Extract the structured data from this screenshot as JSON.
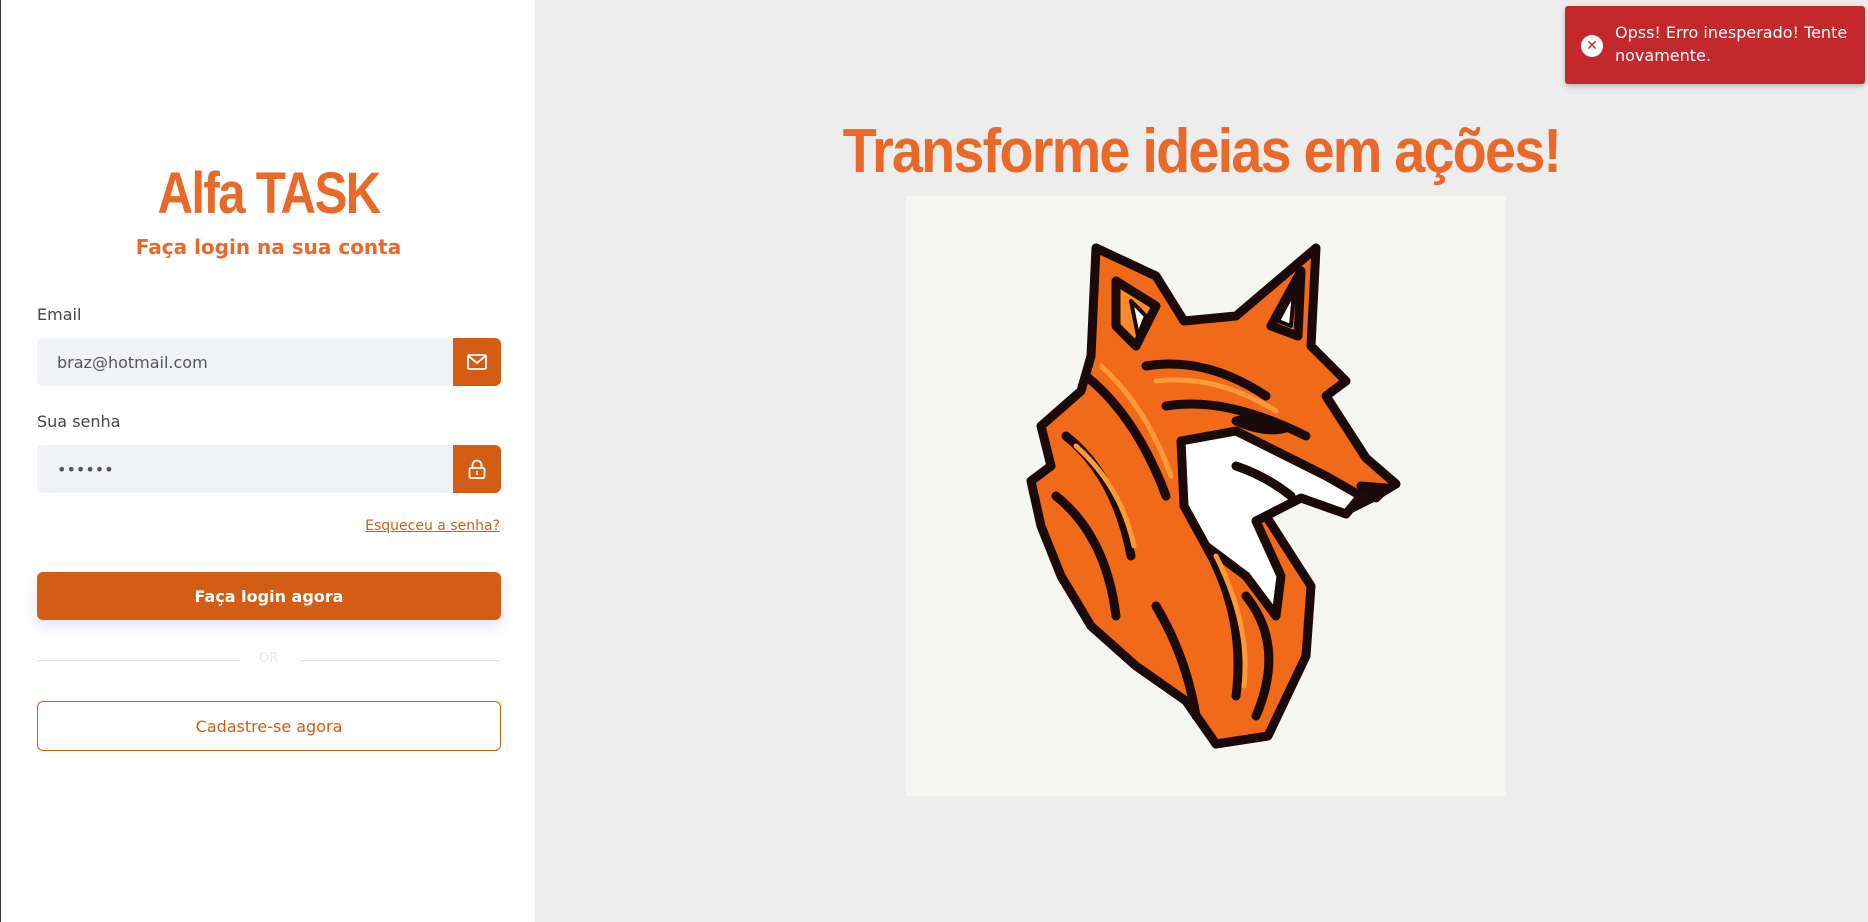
{
  "login": {
    "brand": "Alfa TASK",
    "subtitle": "Faça login na sua conta",
    "email_label": "Email",
    "email_value": "braz@hotmail.com",
    "password_label": "Sua senha",
    "password_value": "••••••",
    "forgot_link": "Esqueceu a senha?",
    "login_button": "Faça login agora",
    "divider_text": "OR",
    "signup_button": "Cadastre-se agora"
  },
  "hero": {
    "title": "Transforme ideias em ações!",
    "image_icon": "fox-logo-icon"
  },
  "toast": {
    "message": "Opss! Erro inesperado! Tente novamente.",
    "icon": "close-circle-icon",
    "color": "#c2282c"
  },
  "colors": {
    "accent": "#d15e14",
    "title_orange": "#e8692a",
    "panel_bg": "#ededed"
  }
}
